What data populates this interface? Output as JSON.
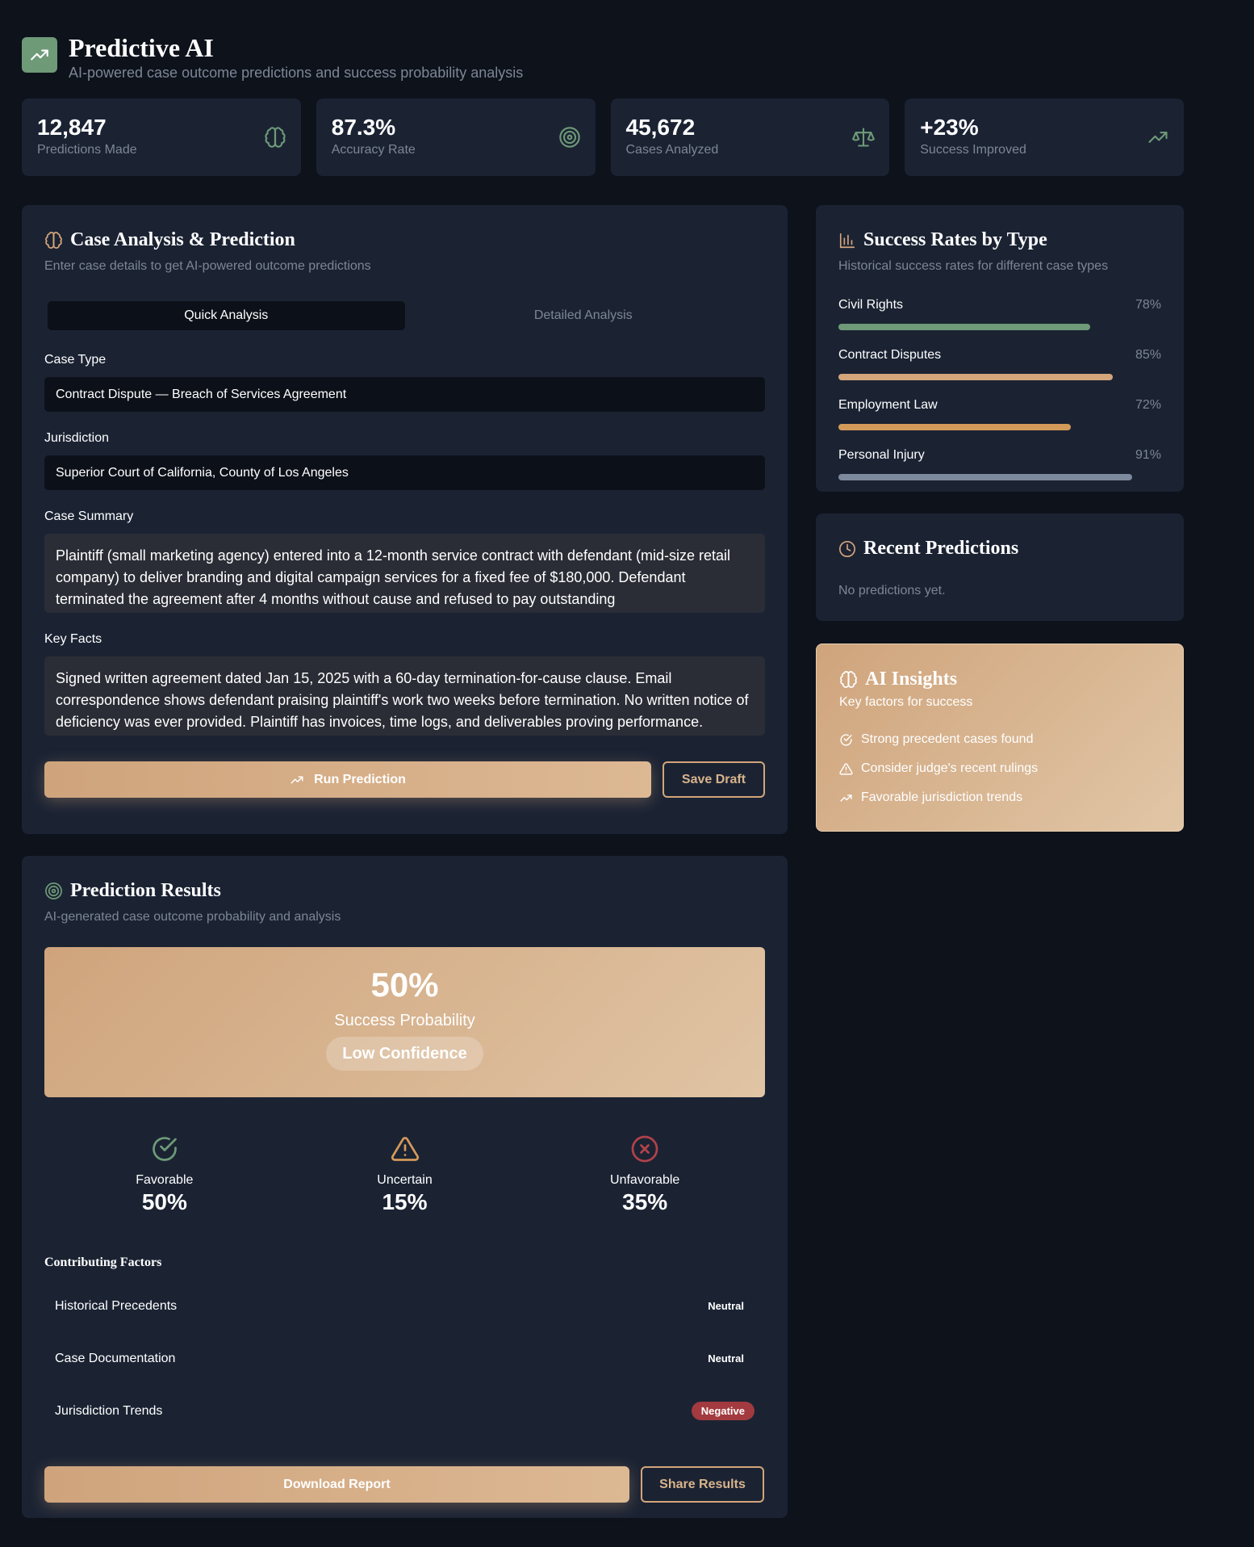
{
  "header": {
    "title": "Predictive AI",
    "subtitle": "AI-powered case outcome predictions and success probability analysis",
    "icon": "trending-up-icon"
  },
  "stats": [
    {
      "value": "12,847",
      "label": "Predictions Made",
      "icon": "brain-icon"
    },
    {
      "value": "87.3%",
      "label": "Accuracy Rate",
      "icon": "target-icon"
    },
    {
      "value": "45,672",
      "label": "Cases Analyzed",
      "icon": "scale-icon"
    },
    {
      "value": "+23%",
      "label": "Success Improved",
      "icon": "trending-up-icon"
    }
  ],
  "case_analysis": {
    "title": "Case Analysis & Prediction",
    "subtitle": "Enter case details to get AI-powered outcome predictions",
    "tabs": [
      {
        "label": "Quick Analysis",
        "active": true
      },
      {
        "label": "Detailed Analysis",
        "active": false
      }
    ],
    "case_type": {
      "label": "Case Type",
      "value": "Contract Dispute — Breach of Services Agreement"
    },
    "jurisdiction": {
      "label": "Jurisdiction",
      "value": "Superior Court of California, County of Los Angeles"
    },
    "case_summary": {
      "label": "Case Summary",
      "value": "Plaintiff (small marketing agency) entered into a 12-month service contract with defendant (mid-size retail company) to deliver branding and digital campaign services for a fixed fee of $180,000. Defendant terminated the agreement after 4 months without cause and refused to pay outstanding"
    },
    "key_facts": {
      "label": "Key Facts",
      "value": "Signed written agreement dated Jan 15, 2025 with a 60-day termination-for-cause clause. Email correspondence shows defendant praising plaintiff's work two weeks before termination. No written notice of deficiency was ever provided. Plaintiff has invoices, time logs, and deliverables proving performance. Defendant claims \"quality concerns\" but produced no documentation. Liquidated"
    },
    "run_label": "Run Prediction",
    "save_label": "Save Draft"
  },
  "results": {
    "title": "Prediction Results",
    "subtitle": "AI-generated case outcome probability and analysis",
    "probability": "50%",
    "probability_label": "Success Probability",
    "confidence": "Low Confidence",
    "outcomes": [
      {
        "label": "Favorable",
        "value": "50%",
        "color": "#6e9a78",
        "icon": "check-circle-icon"
      },
      {
        "label": "Uncertain",
        "value": "15%",
        "color": "#d49a5a",
        "icon": "alert-triangle-icon"
      },
      {
        "label": "Unfavorable",
        "value": "35%",
        "color": "#b0424a",
        "icon": "x-circle-icon"
      }
    ],
    "factors_title": "Contributing Factors",
    "factors": [
      {
        "name": "Historical Precedents",
        "impact": "Neutral"
      },
      {
        "name": "Case Documentation",
        "impact": "Neutral"
      },
      {
        "name": "Jurisdiction Trends",
        "impact": "Negative"
      }
    ],
    "download_label": "Download Report",
    "share_label": "Share Results"
  },
  "success_rates": {
    "title": "Success Rates by Type",
    "subtitle": "Historical success rates for different case types",
    "items": [
      {
        "name": "Civil Rights",
        "pct_label": "78%",
        "value": 78,
        "color": "#6e9a78"
      },
      {
        "name": "Contract Disputes",
        "pct_label": "85%",
        "value": 85,
        "color": "#d4a57a"
      },
      {
        "name": "Employment Law",
        "pct_label": "72%",
        "value": 72,
        "color": "#d49a5a"
      },
      {
        "name": "Personal Injury",
        "pct_label": "91%",
        "value": 91,
        "color": "#7d8a9e"
      }
    ]
  },
  "recent_predictions": {
    "title": "Recent Predictions",
    "empty_text": "No predictions yet."
  },
  "insights": {
    "title": "AI Insights",
    "subtitle": "Key factors for success",
    "items": [
      {
        "text": "Strong precedent cases found",
        "icon": "check-circle-icon"
      },
      {
        "text": "Consider judge's recent rulings",
        "icon": "alert-triangle-icon"
      },
      {
        "text": "Favorable jurisdiction trends",
        "icon": "trending-up-icon"
      }
    ]
  },
  "colors": {
    "background": "#0d121b",
    "card": "#1b2333",
    "accent": "#d4a57a",
    "green": "#6e9a78",
    "negative": "#a23a3f"
  }
}
